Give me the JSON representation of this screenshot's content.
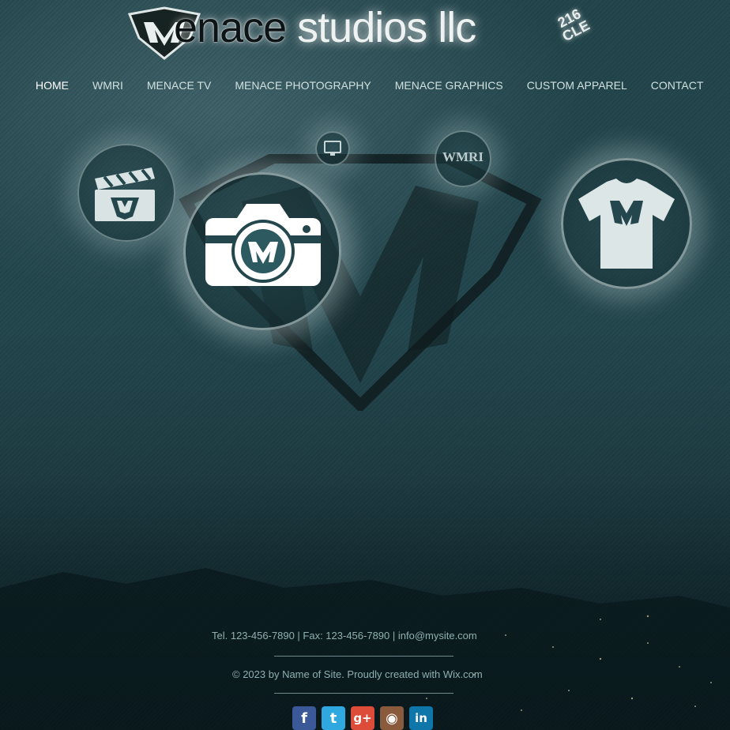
{
  "brand": {
    "logo_m": "M",
    "title_dark": "enace",
    "title_light": "studios llc",
    "badge_line1": "216",
    "badge_line2": "CLE"
  },
  "nav": {
    "items": [
      {
        "label": "HOME"
      },
      {
        "label": "WMRI"
      },
      {
        "label": "MENACE TV"
      },
      {
        "label": "MENACE PHOTOGRAPHY"
      },
      {
        "label": "MENACE GRAPHICS"
      },
      {
        "label": "CUSTOM APPAREL"
      },
      {
        "label": "CONTACT"
      }
    ],
    "active_color": "#ffffff",
    "color": "#cfe0df"
  },
  "icons": {
    "tv_icon": "clapperboard-icon",
    "photo_icon": "camera-icon",
    "apparel_icon": "tshirt-icon",
    "graphics_icon": "monitor-icon",
    "wmri_icon": "wmri-badge-icon",
    "wmri_text": "WMRI"
  },
  "footer": {
    "contact": "Tel. 123-456-7890  |  Fax: 123-456-7890  |  info@mysite.com",
    "copyright": "© 2023 by Name of Site. Proudly created with Wix.com"
  },
  "social": [
    {
      "name": "facebook-icon",
      "glyph": "f",
      "color": "#3b5998"
    },
    {
      "name": "twitter-icon",
      "glyph": "t",
      "color": "#2fa7df"
    },
    {
      "name": "google-plus-icon",
      "glyph": "g+",
      "color": "#dd4b39"
    },
    {
      "name": "instagram-icon",
      "glyph": "◉",
      "color": "#8a5a3c"
    },
    {
      "name": "linkedin-icon",
      "glyph": "in",
      "color": "#0e76a8"
    }
  ],
  "colors": {
    "background": "#24474d",
    "accent": "#eef3f2"
  }
}
